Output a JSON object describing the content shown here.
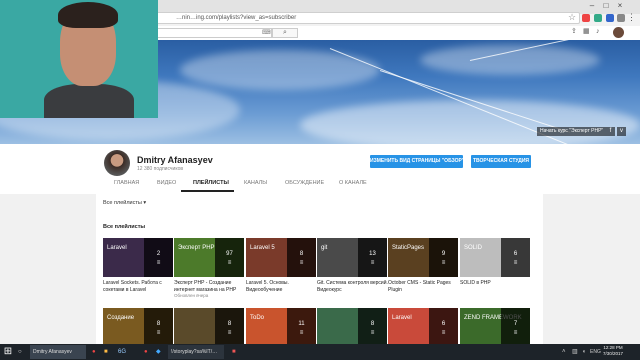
{
  "browser": {
    "url": "…nin…ing.com/playlists?view_as=subscriber",
    "window_controls": [
      "–",
      "□",
      "×"
    ]
  },
  "youtube": {
    "search_placeholder": "",
    "search_icon": "search-icon"
  },
  "banner": {
    "link_label": "Начать курс \"Эксперт PHP\"",
    "social_icons": [
      "f",
      "v"
    ]
  },
  "channel": {
    "name": "Dmitry Afanasyev",
    "subscribers": "12 380 подписчиков",
    "view_as_button": "ИЗМЕНИТЬ ВИД СТРАНИЦЫ \"ОБЗОР\"",
    "studio_button": "ТВОРЧЕСКАЯ СТУДИЯ"
  },
  "tabs": [
    {
      "label": "ГЛАВНАЯ",
      "active": false
    },
    {
      "label": "ВИДЕО",
      "active": false
    },
    {
      "label": "ПЛЕЙЛИСТЫ",
      "active": true
    },
    {
      "label": "КАНАЛЫ",
      "active": false
    },
    {
      "label": "ОБСУЖДЕНИЕ",
      "active": false
    },
    {
      "label": "О КАНАЛЕ",
      "active": false
    }
  ],
  "content": {
    "filter_label": "Все плейлисты",
    "section_title": "Все плейлисты",
    "playlists": [
      {
        "thumb_text": "Laravel",
        "count": "2",
        "title": "Laravel Sockets. Работа с сокетами в Laravel",
        "meta": "",
        "color": "#3b2a4a"
      },
      {
        "thumb_text": "Эксперт PHP",
        "count": "97",
        "title": "Эксперт PHP - Создание интернет магазина на PHP",
        "meta": "Обновлен вчера",
        "color": "#4c7a2a"
      },
      {
        "thumb_text": "Laravel 5",
        "count": "8",
        "title": "Laravel 5. Основы. Видеообучение",
        "meta": "",
        "color": "#7a3a2a"
      },
      {
        "thumb_text": "git",
        "count": "13",
        "title": "Git. Система контроля версий. Видеокурс",
        "meta": "",
        "color": "#4a4a4a"
      },
      {
        "thumb_text": "StaticPages",
        "count": "9",
        "title": "October CMS - Static Pages Plugin",
        "meta": "",
        "color": "#5a4020"
      },
      {
        "thumb_text": "SOLID",
        "count": "6",
        "title": "SOLID в PHP",
        "meta": "",
        "color": "#bdbdbd"
      },
      {
        "thumb_text": "Создание",
        "count": "8",
        "title": "",
        "meta": "",
        "color": "#7a5a20"
      },
      {
        "thumb_text": "",
        "count": "8",
        "title": "",
        "meta": "",
        "color": "#5a4a2a"
      },
      {
        "thumb_text": "ToDo",
        "count": "11",
        "title": "",
        "meta": "",
        "color": "#c9542d"
      },
      {
        "thumb_text": "",
        "count": "8",
        "title": "",
        "meta": "",
        "color": "#3a6a4a"
      },
      {
        "thumb_text": "Laravel",
        "count": "6",
        "title": "",
        "meta": "",
        "color": "#c94a3a"
      },
      {
        "thumb_text": "ZEND FRAMEWORK",
        "count": "7",
        "title": "",
        "meta": "",
        "color": "#3b6a2a"
      }
    ]
  },
  "taskbar": {
    "items": [
      "Dmitry Afanasyev",
      "!/storyplay?sa%IT/…"
    ],
    "clock": "12:28 PM\n7/30/2017",
    "lang": "ENG",
    "tray_label": "6G"
  }
}
